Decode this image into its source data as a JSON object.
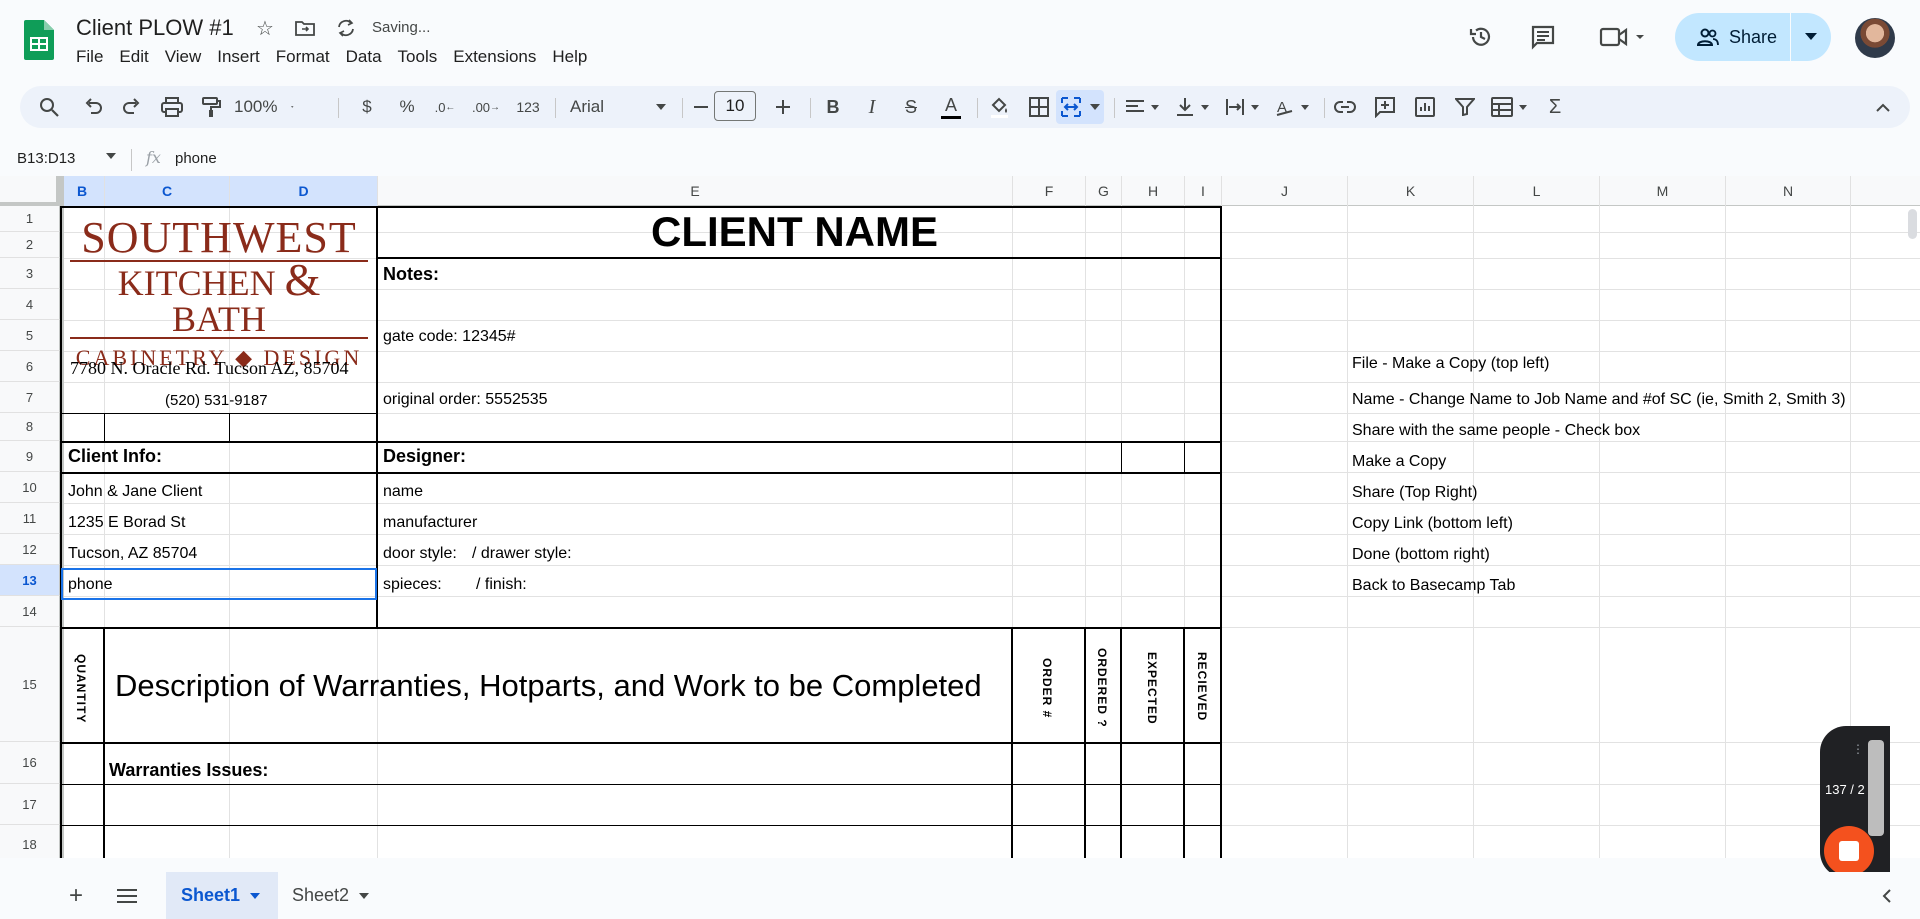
{
  "app": {
    "doc_title": "Client PLOW #1",
    "saving_status": "Saving...",
    "menus": [
      "File",
      "Edit",
      "View",
      "Insert",
      "Format",
      "Data",
      "Tools",
      "Extensions",
      "Help"
    ],
    "share_label": "Share"
  },
  "toolbar": {
    "zoom": "100%",
    "currency": "$",
    "percent": "%",
    "dec_decrease": ".0",
    "dec_increase": ".00",
    "format_123": "123",
    "font": "Arial",
    "font_size": "10"
  },
  "formula_bar": {
    "name_box": "B13:D13",
    "fx": "fx",
    "value": "phone"
  },
  "columns": [
    "B",
    "C",
    "D",
    "E",
    "F",
    "G",
    "H",
    "I",
    "J",
    "K",
    "L",
    "M",
    "N"
  ],
  "rows": [
    "1",
    "2",
    "3",
    "4",
    "5",
    "6",
    "7",
    "8",
    "9",
    "10",
    "11",
    "12",
    "13",
    "14",
    "15",
    "16",
    "17",
    "18"
  ],
  "sheet": {
    "logo": {
      "line1": "SOUTHWEST",
      "line2a": "KITCHEN",
      "amp": "&",
      "line2b": "BATH",
      "line3": "CABINETRY ◆ DESIGN"
    },
    "address": "7780 N. Oracle Rd. Tucson AZ, 85704",
    "phone_company": "(520) 531-9187",
    "client_name": "CLIENT NAME",
    "notes_label": "Notes:",
    "gate_code": "gate code: 12345#",
    "original_order": "original order: 5552535",
    "client_info_label": "Client Info:",
    "designer_label": "Designer:",
    "client_name_line": "John & Jane Client",
    "client_street": "1235 E Borad St",
    "client_city": "Tucson, AZ 85704",
    "client_phone": "phone",
    "designer_name": "name",
    "manufacturer": "manufacturer",
    "door_style": "door style:",
    "drawer_style": "/ drawer style:",
    "species": "spieces:",
    "finish": "/ finish:",
    "quantity_hdr": "QUANTITY",
    "description_hdr": "Description of Warranties, Hotparts, and Work to be Completed",
    "order_hdr": "ORDER #",
    "ordered_hdr": "ORDERED ?",
    "expected_hdr": "EXPECTED",
    "received_hdr": "RECIEVED",
    "warranties_label": "Warranties Issues:",
    "instructions": [
      "File - Make a Copy (top left)",
      "Name - Change Name to Job Name and #of SC (ie, Smith 2, Smith 3)",
      "Share with the same people - Check box",
      "Make a Copy",
      "Share (Top Right)",
      "Copy Link (bottom left)",
      "Done (bottom right)",
      "Back to Basecamp Tab"
    ]
  },
  "recorder": {
    "count": "137 / 2"
  },
  "tabs": {
    "sheet1": "Sheet1",
    "sheet2": "Sheet2"
  }
}
